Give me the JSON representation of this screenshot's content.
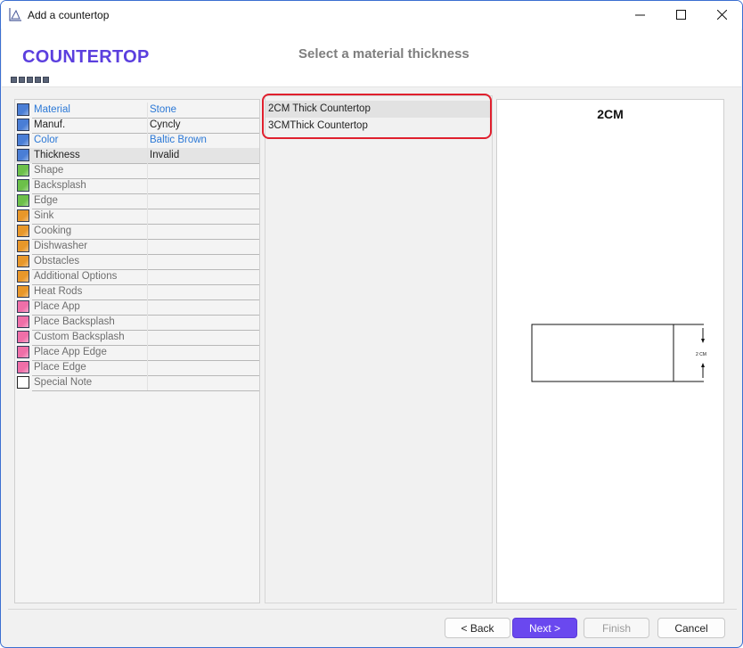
{
  "window": {
    "title": "Add a countertop"
  },
  "header": {
    "title": "COUNTERTOP",
    "subtitle": "Select a material thickness",
    "steps_count": 5
  },
  "properties": [
    {
      "name": "Material",
      "value": "Stone",
      "color": "#4a7ed6",
      "link": true
    },
    {
      "name": "Manuf.",
      "value": "Cyncly",
      "color": "#4a7ed6",
      "link": false
    },
    {
      "name": "Color",
      "value": "Baltic Brown",
      "color": "#4a7ed6",
      "link": true
    },
    {
      "name": "Thickness",
      "value": "Invalid",
      "color": "#4a7ed6",
      "link": false,
      "selected": true
    },
    {
      "name": "Shape",
      "value": "",
      "color": "#6cc04a",
      "muted": true
    },
    {
      "name": "Backsplash",
      "value": "",
      "color": "#6cc04a",
      "muted": true
    },
    {
      "name": "Edge",
      "value": "",
      "color": "#6cc04a",
      "muted": true
    },
    {
      "name": "Sink",
      "value": "",
      "color": "#e8972a",
      "muted": true
    },
    {
      "name": "Cooking",
      "value": "",
      "color": "#e8972a",
      "muted": true
    },
    {
      "name": "Dishwasher",
      "value": "",
      "color": "#e8972a",
      "muted": true
    },
    {
      "name": "Obstacles",
      "value": "",
      "color": "#e8972a",
      "muted": true
    },
    {
      "name": "Additional Options",
      "value": "",
      "color": "#e8972a",
      "muted": true
    },
    {
      "name": "Heat Rods",
      "value": "",
      "color": "#e8972a",
      "muted": true
    },
    {
      "name": "Place App",
      "value": "",
      "color": "#ef6fa8",
      "muted": true
    },
    {
      "name": "Place Backsplash",
      "value": "",
      "color": "#ef6fa8",
      "muted": true
    },
    {
      "name": "Custom Backsplash",
      "value": "",
      "color": "#ef6fa8",
      "muted": true
    },
    {
      "name": "Place App Edge",
      "value": "",
      "color": "#ef6fa8",
      "muted": true
    },
    {
      "name": "Place Edge",
      "value": "",
      "color": "#ef6fa8",
      "muted": true
    },
    {
      "name": "Special Note",
      "value": "",
      "color": "#ffffff",
      "muted": true
    }
  ],
  "thickness_options": [
    {
      "label": "2CM Thick Countertop",
      "selected": true
    },
    {
      "label": "3CMThick Countertop",
      "selected": false
    }
  ],
  "preview": {
    "title": "2CM",
    "dimension_label": "2 CM"
  },
  "buttons": {
    "back": "< Back",
    "next": "Next >",
    "finish": "Finish",
    "cancel": "Cancel"
  }
}
